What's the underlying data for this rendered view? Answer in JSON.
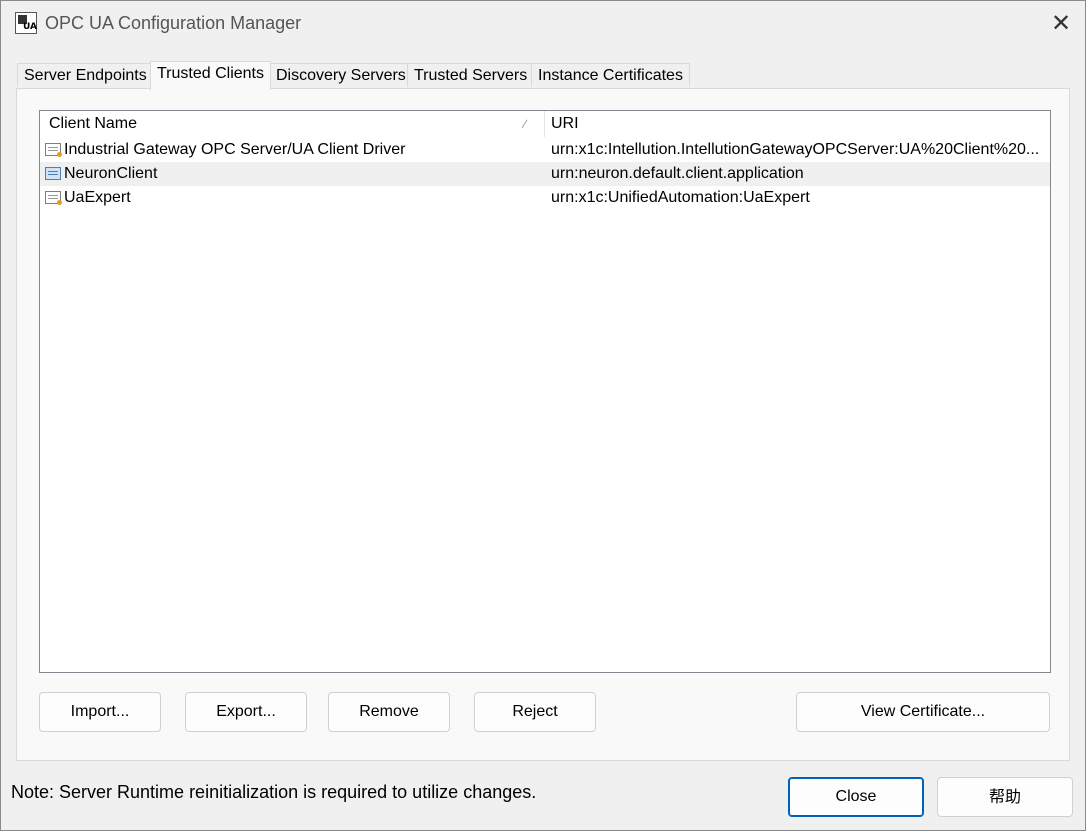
{
  "window": {
    "title": "OPC UA Configuration Manager",
    "close_glyph": "✕",
    "app_icon": "opc-ua-icon",
    "icon_text": "UA"
  },
  "tabs": [
    {
      "label": "Server Endpoints",
      "active": false
    },
    {
      "label": "Trusted Clients",
      "active": true
    },
    {
      "label": "Discovery Servers",
      "active": false
    },
    {
      "label": "Trusted Servers",
      "active": false
    },
    {
      "label": "Instance Certificates",
      "active": false
    }
  ],
  "list": {
    "columns": {
      "name": "Client Name",
      "uri": "URI",
      "sort_glyph": "∕"
    },
    "rows": [
      {
        "name": "Industrial Gateway OPC Server/UA Client Driver",
        "uri": "urn:x1c:Intellution.IntellutionGatewayOPCServer:UA%20Client%20...",
        "icon": "certificate-icon"
      },
      {
        "name": "NeuronClient",
        "uri": "urn:neuron.default.client.application",
        "icon": "certificate-icon"
      },
      {
        "name": "UaExpert",
        "uri": "urn:x1c:UnifiedAutomation:UaExpert",
        "icon": "certificate-icon"
      }
    ]
  },
  "buttons": {
    "import": "Import...",
    "export": "Export...",
    "remove": "Remove",
    "reject": "Reject",
    "view_certificate": "View Certificate...",
    "close": "Close",
    "help": "帮助"
  },
  "note": "Note: Server Runtime reinitialization is required to utilize changes."
}
